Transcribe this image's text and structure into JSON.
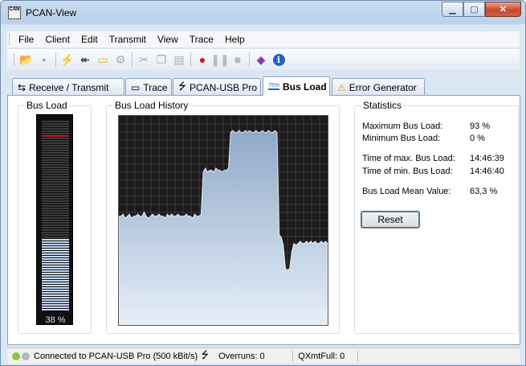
{
  "window": {
    "title": "PCAN-View",
    "app_icon": "CAN"
  },
  "menu": [
    "File",
    "Client",
    "Edit",
    "Transmit",
    "View",
    "Trace",
    "Help"
  ],
  "toolbar": {
    "icons": [
      "open-folder-icon",
      "save-icon",
      "connect-lightning-icon",
      "disconnect-icon",
      "trace-folder-icon",
      "settings-icon",
      "cut-icon",
      "copy-icon",
      "paste-icon",
      "record-icon",
      "pause-icon",
      "stop-icon",
      "help-book-icon",
      "info-icon"
    ]
  },
  "tabs": [
    {
      "label": "Receive / Transmit",
      "icon": "receive-transmit-icon",
      "active": false
    },
    {
      "label": "Trace",
      "icon": "trace-icon",
      "active": false
    },
    {
      "label": "PCAN-USB Pro",
      "icon": "usb-icon",
      "active": false
    },
    {
      "label": "Bus Load",
      "icon": "bus-load-icon",
      "badge": "75%",
      "active": true
    },
    {
      "label": "Error Generator",
      "icon": "warning-icon",
      "active": false
    }
  ],
  "bus_load": {
    "label": "Bus Load",
    "current_percent": 38,
    "display": "38 %",
    "max_marker_percent": 93
  },
  "history": {
    "label": "Bus Load History",
    "values": [
      52,
      52,
      53,
      51,
      52,
      53,
      51,
      52,
      52,
      53,
      52,
      52,
      54,
      52,
      51,
      52,
      53,
      52,
      52,
      53,
      52,
      52,
      51,
      53,
      52,
      53,
      52,
      52,
      53,
      52,
      52,
      52,
      53,
      52,
      52,
      51,
      53,
      52,
      52,
      53,
      73,
      75,
      73,
      74,
      74,
      73,
      75,
      74,
      74,
      73,
      74,
      74,
      75,
      92,
      93,
      92,
      92,
      93,
      92,
      92,
      93,
      92,
      93,
      92,
      92,
      93,
      92,
      92,
      93,
      92,
      92,
      93,
      92,
      92,
      93,
      92,
      43,
      42,
      38,
      27,
      26,
      27,
      35,
      39,
      38,
      39,
      40,
      39,
      39,
      40,
      39,
      40,
      39,
      40,
      39,
      39,
      40,
      39,
      40,
      39
    ]
  },
  "statistics": {
    "label": "Statistics",
    "rows": [
      {
        "label": "Maximum Bus Load:",
        "value": "93 %"
      },
      {
        "label": "Minimum Bus Load:",
        "value": "0 %"
      },
      {
        "label": "Time of max. Bus Load:",
        "value": "14:46:39"
      },
      {
        "label": "Time of min. Bus Load:",
        "value": "14:46:40"
      },
      {
        "label": "Bus Load Mean Value:",
        "value": "63,3 %"
      }
    ],
    "reset_label": "Reset"
  },
  "status": {
    "connection": "Connected to PCAN-USB Pro (500 kBit/s)",
    "overruns": "Overruns: 0",
    "qxmtfull": "QXmtFull: 0",
    "colors": {
      "led1": "#8cc63f",
      "led2": "#b0b8c4"
    }
  }
}
